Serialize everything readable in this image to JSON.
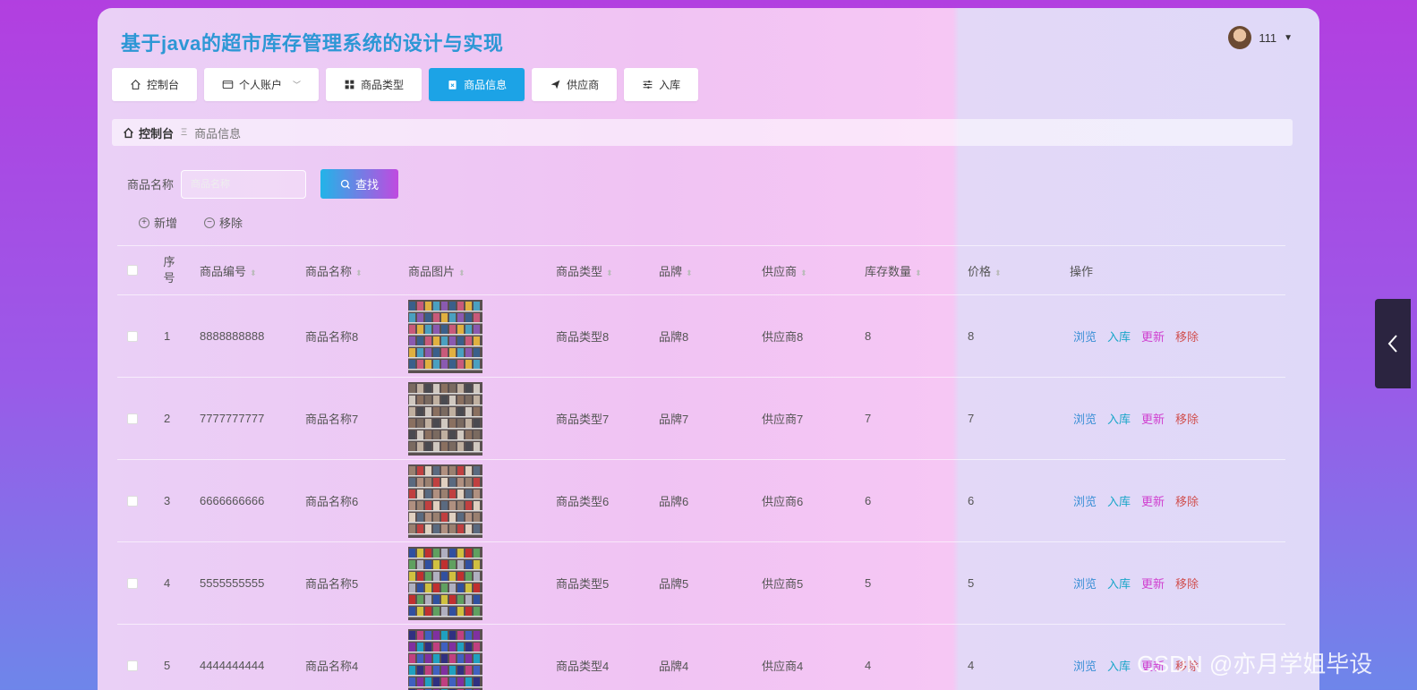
{
  "app": {
    "title": "基于java的超市库存管理系统的设计与实现",
    "user": "111"
  },
  "nav": [
    {
      "label": "控制台",
      "icon": "home-icon"
    },
    {
      "label": "个人账户",
      "icon": "card-icon"
    },
    {
      "label": "商品类型",
      "icon": "grid-icon"
    },
    {
      "label": "商品信息",
      "icon": "clipboard-icon"
    },
    {
      "label": "供应商",
      "icon": "send-icon"
    },
    {
      "label": "入库",
      "icon": "sliders-icon"
    }
  ],
  "breadcrumb": {
    "home": "控制台",
    "separator": "Ξ",
    "current": "商品信息"
  },
  "search": {
    "label": "商品名称",
    "placeholder": "商品名称",
    "button": "查找"
  },
  "actions": {
    "add": "新增",
    "remove": "移除"
  },
  "table": {
    "headers": {
      "index": "序号",
      "code": "商品编号",
      "name": "商品名称",
      "image": "商品图片",
      "type": "商品类型",
      "brand": "品牌",
      "supplier": "供应商",
      "stock": "库存数量",
      "price": "价格",
      "ops": "操作"
    },
    "rows": [
      {
        "index": "1",
        "code": "8888888888",
        "name": "商品名称8",
        "type": "商品类型8",
        "brand": "品牌8",
        "supplier": "供应商8",
        "stock": "8",
        "price": "8"
      },
      {
        "index": "2",
        "code": "7777777777",
        "name": "商品名称7",
        "type": "商品类型7",
        "brand": "品牌7",
        "supplier": "供应商7",
        "stock": "7",
        "price": "7"
      },
      {
        "index": "3",
        "code": "6666666666",
        "name": "商品名称6",
        "type": "商品类型6",
        "brand": "品牌6",
        "supplier": "供应商6",
        "stock": "6",
        "price": "6"
      },
      {
        "index": "4",
        "code": "5555555555",
        "name": "商品名称5",
        "type": "商品类型5",
        "brand": "品牌5",
        "supplier": "供应商5",
        "stock": "5",
        "price": "5"
      },
      {
        "index": "5",
        "code": "4444444444",
        "name": "商品名称4",
        "type": "商品类型4",
        "brand": "品牌4",
        "supplier": "供应商4",
        "stock": "4",
        "price": "4"
      }
    ],
    "ops": {
      "view": "浏览",
      "stock_in": "入库",
      "update": "更新",
      "remove": "移除"
    }
  },
  "watermark": "CSDN @亦月学姐毕设",
  "colors": {
    "accent": "#1ca3e6",
    "title": "#2d97d5"
  }
}
